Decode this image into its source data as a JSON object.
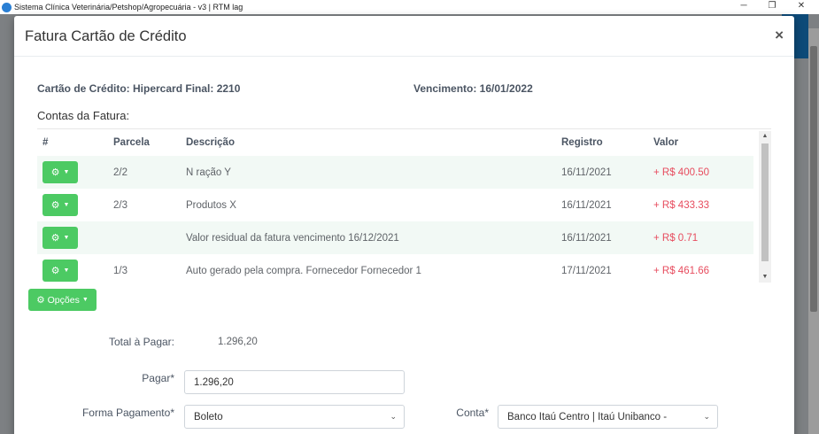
{
  "window": {
    "title": "Sistema Clínica Veterinária/Petshop/Agropecuária - v3 | RTM lag",
    "minimize_glyph": "─",
    "restore_glyph": "❐",
    "close_glyph": "✕"
  },
  "modal": {
    "title": "Fatura Cartão de Crédito",
    "close_glyph": "×",
    "card_label": "Cartão de Crédito: Hipercard Final: 2210",
    "due_label": "Vencimento: 16/01/2022",
    "section_label": "Contas da Fatura:",
    "table": {
      "headers": [
        "#",
        "Parcela",
        "Descrição",
        "Registro",
        "Valor"
      ],
      "rows": [
        {
          "parcela": "2/2",
          "descricao": "N ração Y",
          "registro": "16/11/2021",
          "valor": "+ R$ 400.50"
        },
        {
          "parcela": "2/3",
          "descricao": "Produtos X",
          "registro": "16/11/2021",
          "valor": "+ R$ 433.33"
        },
        {
          "parcela": "",
          "descricao": "Valor residual da fatura vencimento 16/12/2021",
          "registro": "16/11/2021",
          "valor": "+ R$ 0.71"
        },
        {
          "parcela": "1/3",
          "descricao": "Auto gerado pela compra. Fornecedor Fornecedor 1",
          "registro": "17/11/2021",
          "valor": "+ R$ 461.66"
        }
      ]
    },
    "opcoes_label": "Opções",
    "total_label": "Total à Pagar:",
    "total_value": "1.296,20",
    "pagar_label": "Pagar*",
    "pagar_value": "1.296,20",
    "forma_label": "Forma Pagamento*",
    "forma_value": "Boleto",
    "conta_label": "Conta*",
    "conta_value": "Banco Itaú Centro | Itaú Unibanco -"
  },
  "icons": {
    "gear": "⚙",
    "caret": "▼",
    "chevron": "⌄"
  }
}
